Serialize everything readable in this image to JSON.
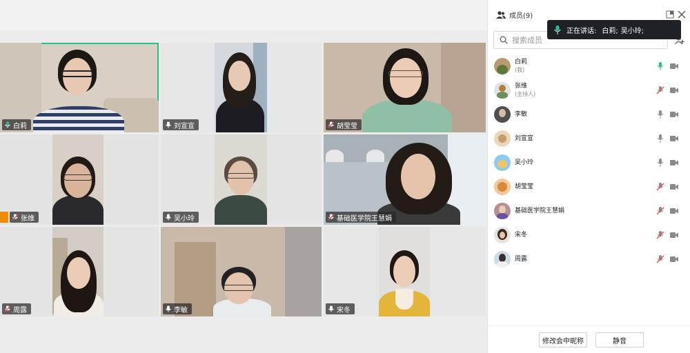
{
  "sidebar": {
    "title": "成员(9)",
    "speaking_label": "正在讲话:",
    "speaking_names": [
      "白莉;",
      "吴小玲;"
    ],
    "search_placeholder": "搜索成员",
    "footer": {
      "rename_label": "修改会中昵称",
      "mute_label": "静音"
    },
    "members": [
      {
        "name": "白莉",
        "role": "(我)",
        "mic": "on-active",
        "avatar_color": "#b89a6e"
      },
      {
        "name": "张维",
        "role": "(主持人)",
        "mic": "muted",
        "avatar_color": "#c9c9c9"
      },
      {
        "name": "李敏",
        "role": "",
        "mic": "on",
        "avatar_color": "#555"
      },
      {
        "name": "刘宣宣",
        "role": "",
        "mic": "on",
        "avatar_color": "#e8d4b8"
      },
      {
        "name": "吴小玲",
        "role": "",
        "mic": "on",
        "avatar_color": "#6fb3e0"
      },
      {
        "name": "胡莹莹",
        "role": "",
        "mic": "muted",
        "avatar_color": "#e8a96b"
      },
      {
        "name": "基础医学院王慧娟",
        "role": "",
        "mic": "muted",
        "avatar_color": "#9a6b6b"
      },
      {
        "name": "宋冬",
        "role": "",
        "mic": "muted",
        "avatar_color": "#7a6458"
      },
      {
        "name": "周露",
        "role": "",
        "mic": "muted",
        "avatar_color": "#8ab0c8"
      }
    ]
  },
  "tiles": [
    {
      "name": "白莉",
      "mic": "speaking",
      "active": true,
      "bg": "#d9cfc4"
    },
    {
      "name": "刘宣宣",
      "mic": "on",
      "active": false,
      "bg": "#e6e6e6"
    },
    {
      "name": "胡莹莹",
      "mic": "muted",
      "active": false,
      "bg": "#c9b9a8"
    },
    {
      "name": "张维",
      "mic": "muted",
      "active": false,
      "host": true,
      "bg": "#e3e3e3"
    },
    {
      "name": "吴小玲",
      "mic": "on",
      "active": false,
      "bg": "#e4e4e4"
    },
    {
      "name": "基础医学院王慧娟",
      "mic": "muted",
      "active": false,
      "bg": "#b9c2c8"
    },
    {
      "name": "周露",
      "mic": "muted",
      "active": false,
      "bg": "#e4e4e4"
    },
    {
      "name": "李敏",
      "mic": "on",
      "active": false,
      "bg": "#c8b9a8"
    },
    {
      "name": "宋冬",
      "mic": "on",
      "active": false,
      "bg": "#e6e6e6"
    }
  ],
  "colors": {
    "active_border": "#27c08a",
    "mic_active": "#27c08a",
    "mic_muted": "#d9534f",
    "icon_gray": "#8a8a8a"
  }
}
